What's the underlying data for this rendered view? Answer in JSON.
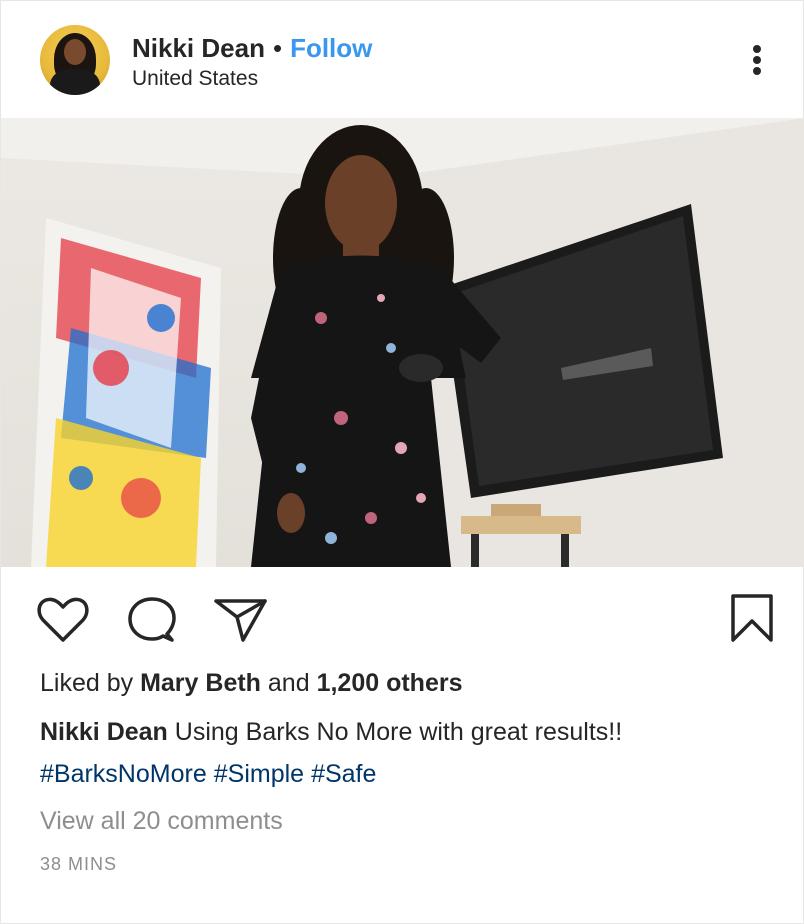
{
  "post": {
    "author_name": "Nikki Dean",
    "separator": "•",
    "follow_label": "Follow",
    "location": "United States"
  },
  "likes": {
    "prefix": "Liked by",
    "first_liker": "Mary Beth",
    "conjunction": "and",
    "others": "1,200 others"
  },
  "caption": {
    "author": "Nikki Dean",
    "text": "Using Barks No More with great results!!"
  },
  "hashtags": [
    "#BarksNoMore",
    "#Simple",
    "#Safe"
  ],
  "comments_link": "View all 20 comments",
  "timestamp": "38 MINS",
  "icons": {
    "more": "more-options-icon",
    "like": "heart-icon",
    "comment": "comment-bubble-icon",
    "share": "paper-plane-icon",
    "save": "bookmark-icon"
  },
  "colors": {
    "follow": "#3897f0",
    "hashtag": "#003569",
    "muted": "#8e8e8e",
    "text": "#262626"
  }
}
